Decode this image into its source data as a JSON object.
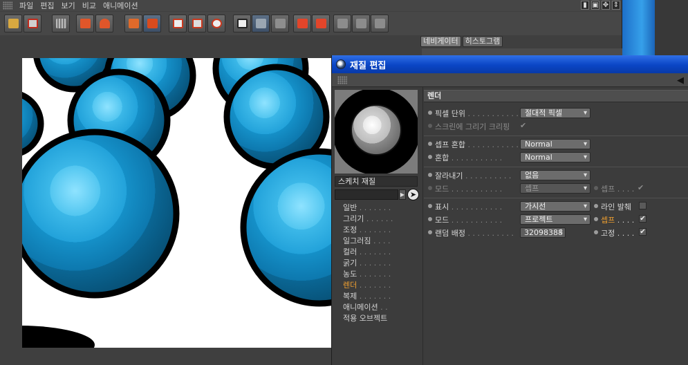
{
  "menu": [
    "파일",
    "편집",
    "보기",
    "비교",
    "애니메이션"
  ],
  "nav_tabs": [
    "네비게이터",
    "히스토그램"
  ],
  "dialog": {
    "title": "재질 편집",
    "material_name": "스케치 재질",
    "channels": [
      {
        "label": "일반",
        "dots": " . . . . . . ."
      },
      {
        "label": "그리기",
        "dots": " . . . . . ."
      },
      {
        "label": "조정",
        "dots": " . . . . . . ."
      },
      {
        "label": "일그러짐",
        "dots": " . . . ."
      },
      {
        "label": "컬러",
        "dots": " . . . . . . ."
      },
      {
        "label": "굵기",
        "dots": " . . . . . . ."
      },
      {
        "label": "농도",
        "dots": " . . . . . . ."
      },
      {
        "label": "렌더",
        "dots": " . . . . . . ."
      },
      {
        "label": "복제",
        "dots": " . . . . . . ."
      },
      {
        "label": "애니메이션",
        "dots": " . ."
      },
      {
        "label": "적용 오브젝트",
        "dots": ""
      }
    ],
    "section": "렌더",
    "pixel_units_label": "픽셀 단위",
    "pixel_units_value": "절대적 픽셀",
    "screen_clip_label": "스크린에 그리기 크리핑",
    "sep_blend_label": "셉프 혼합",
    "sep_blend_value": "Normal",
    "blend_label": "혼합",
    "blend_value": "Normal",
    "crop_label": "잘라내기",
    "crop_value": "없음",
    "mode1_label": "모드",
    "mode1_value": "셉프",
    "sep_check_label": "셉프",
    "display_label": "표시",
    "display_value": "가시선",
    "line_exclude_label": "라인 발췌",
    "mode2_label": "모드",
    "mode2_value": "프로젝트",
    "sep2_label": "셉프",
    "random_seed_label": "랜덤 배정",
    "random_seed_value": "32098388",
    "fixed_label": "고정",
    "dots_long": " . . . . . . . . . . .",
    "dots_mid": " . . . . . . . . . .",
    "dots_short": " . . . ."
  }
}
